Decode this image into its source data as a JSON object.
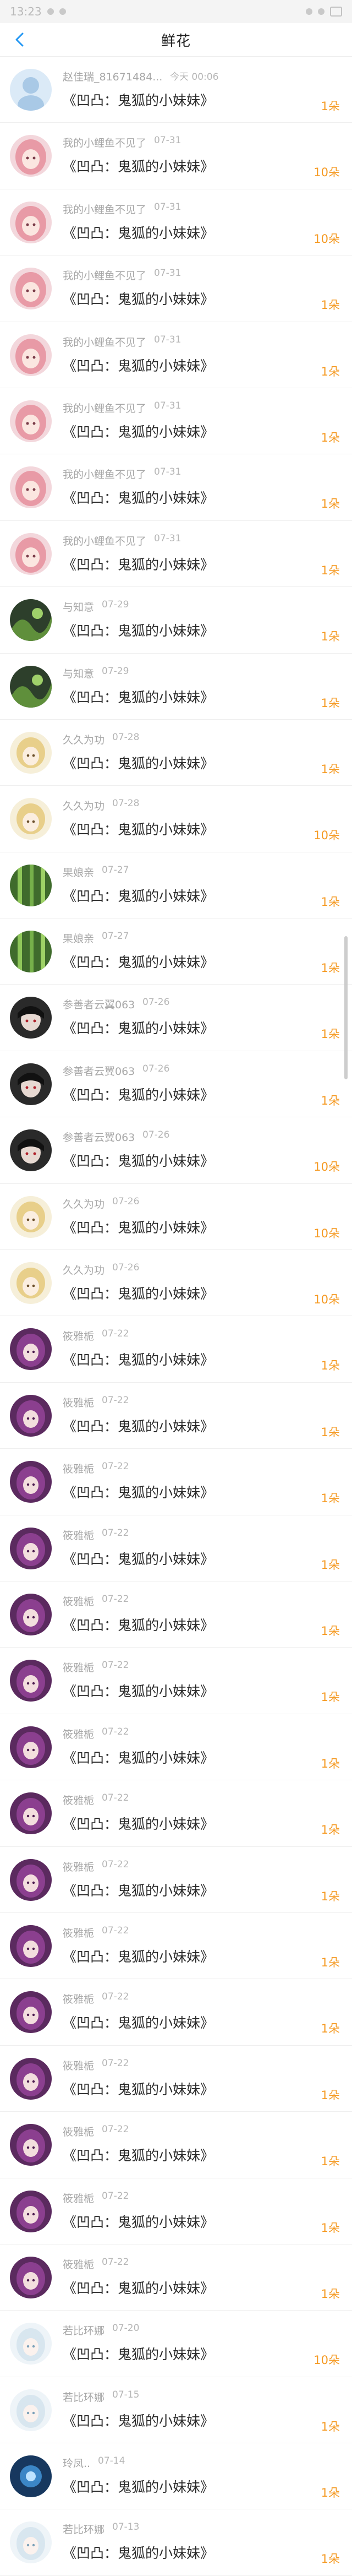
{
  "status": {
    "time": "13:23"
  },
  "header": {
    "title": "鲜花"
  },
  "colors": {
    "accent_count": "#f59a23"
  },
  "rows": [
    {
      "name": "赵佳瑞_81671484...",
      "date": "今天 00:06",
      "gift": "《凹凸：鬼狐的小妹妹》",
      "count": "1朵",
      "avatar": "default"
    },
    {
      "name": "我的小鲤鱼不见了",
      "date": "07-31",
      "gift": "《凹凸：鬼狐的小妹妹》",
      "count": "10朵",
      "avatar": "pink"
    },
    {
      "name": "我的小鲤鱼不见了",
      "date": "07-31",
      "gift": "《凹凸：鬼狐的小妹妹》",
      "count": "10朵",
      "avatar": "pink"
    },
    {
      "name": "我的小鲤鱼不见了",
      "date": "07-31",
      "gift": "《凹凸：鬼狐的小妹妹》",
      "count": "1朵",
      "avatar": "pink"
    },
    {
      "name": "我的小鲤鱼不见了",
      "date": "07-31",
      "gift": "《凹凸：鬼狐的小妹妹》",
      "count": "1朵",
      "avatar": "pink"
    },
    {
      "name": "我的小鲤鱼不见了",
      "date": "07-31",
      "gift": "《凹凸：鬼狐的小妹妹》",
      "count": "1朵",
      "avatar": "pink"
    },
    {
      "name": "我的小鲤鱼不见了",
      "date": "07-31",
      "gift": "《凹凸：鬼狐的小妹妹》",
      "count": "1朵",
      "avatar": "pink"
    },
    {
      "name": "我的小鲤鱼不见了",
      "date": "07-31",
      "gift": "《凹凸：鬼狐的小妹妹》",
      "count": "1朵",
      "avatar": "pink"
    },
    {
      "name": "与知意",
      "date": "07-29",
      "gift": "《凹凸：鬼狐的小妹妹》",
      "count": "1朵",
      "avatar": "greendark"
    },
    {
      "name": "与知意",
      "date": "07-29",
      "gift": "《凹凸：鬼狐的小妹妹》",
      "count": "1朵",
      "avatar": "greendark"
    },
    {
      "name": "久久为功",
      "date": "07-28",
      "gift": "《凹凸：鬼狐的小妹妹》",
      "count": "1朵",
      "avatar": "blonde"
    },
    {
      "name": "久久为功",
      "date": "07-28",
      "gift": "《凹凸：鬼狐的小妹妹》",
      "count": "10朵",
      "avatar": "blonde"
    },
    {
      "name": "果娘亲",
      "date": "07-27",
      "gift": "《凹凸：鬼狐的小妹妹》",
      "count": "1朵",
      "avatar": "bamboo"
    },
    {
      "name": "果娘亲",
      "date": "07-27",
      "gift": "《凹凸：鬼狐的小妹妹》",
      "count": "1朵",
      "avatar": "bamboo"
    },
    {
      "name": "参善者云翼063",
      "date": "07-26",
      "gift": "《凹凸：鬼狐的小妹妹》",
      "count": "1朵",
      "avatar": "dark"
    },
    {
      "name": "参善者云翼063",
      "date": "07-26",
      "gift": "《凹凸：鬼狐的小妹妹》",
      "count": "1朵",
      "avatar": "dark"
    },
    {
      "name": "参善者云翼063",
      "date": "07-26",
      "gift": "《凹凸：鬼狐的小妹妹》",
      "count": "10朵",
      "avatar": "dark"
    },
    {
      "name": "久久为功",
      "date": "07-26",
      "gift": "《凹凸：鬼狐的小妹妹》",
      "count": "10朵",
      "avatar": "blonde"
    },
    {
      "name": "久久为功",
      "date": "07-26",
      "gift": "《凹凸：鬼狐的小妹妹》",
      "count": "10朵",
      "avatar": "blonde"
    },
    {
      "name": "筱雅栀",
      "date": "07-22",
      "gift": "《凹凸：鬼狐的小妹妹》",
      "count": "1朵",
      "avatar": "purple"
    },
    {
      "name": "筱雅栀",
      "date": "07-22",
      "gift": "《凹凸：鬼狐的小妹妹》",
      "count": "1朵",
      "avatar": "purple"
    },
    {
      "name": "筱雅栀",
      "date": "07-22",
      "gift": "《凹凸：鬼狐的小妹妹》",
      "count": "1朵",
      "avatar": "purple"
    },
    {
      "name": "筱雅栀",
      "date": "07-22",
      "gift": "《凹凸：鬼狐的小妹妹》",
      "count": "1朵",
      "avatar": "purple"
    },
    {
      "name": "筱雅栀",
      "date": "07-22",
      "gift": "《凹凸：鬼狐的小妹妹》",
      "count": "1朵",
      "avatar": "purple"
    },
    {
      "name": "筱雅栀",
      "date": "07-22",
      "gift": "《凹凸：鬼狐的小妹妹》",
      "count": "1朵",
      "avatar": "purple"
    },
    {
      "name": "筱雅栀",
      "date": "07-22",
      "gift": "《凹凸：鬼狐的小妹妹》",
      "count": "1朵",
      "avatar": "purple"
    },
    {
      "name": "筱雅栀",
      "date": "07-22",
      "gift": "《凹凸：鬼狐的小妹妹》",
      "count": "1朵",
      "avatar": "purple"
    },
    {
      "name": "筱雅栀",
      "date": "07-22",
      "gift": "《凹凸：鬼狐的小妹妹》",
      "count": "1朵",
      "avatar": "purple"
    },
    {
      "name": "筱雅栀",
      "date": "07-22",
      "gift": "《凹凸：鬼狐的小妹妹》",
      "count": "1朵",
      "avatar": "purple"
    },
    {
      "name": "筱雅栀",
      "date": "07-22",
      "gift": "《凹凸：鬼狐的小妹妹》",
      "count": "1朵",
      "avatar": "purple"
    },
    {
      "name": "筱雅栀",
      "date": "07-22",
      "gift": "《凹凸：鬼狐的小妹妹》",
      "count": "1朵",
      "avatar": "purple"
    },
    {
      "name": "筱雅栀",
      "date": "07-22",
      "gift": "《凹凸：鬼狐的小妹妹》",
      "count": "1朵",
      "avatar": "purple"
    },
    {
      "name": "筱雅栀",
      "date": "07-22",
      "gift": "《凹凸：鬼狐的小妹妹》",
      "count": "1朵",
      "avatar": "purple"
    },
    {
      "name": "筱雅栀",
      "date": "07-22",
      "gift": "《凹凸：鬼狐的小妹妹》",
      "count": "1朵",
      "avatar": "purple"
    },
    {
      "name": "若比环娜",
      "date": "07-20",
      "gift": "《凹凸：鬼狐的小妹妹》",
      "count": "10朵",
      "avatar": "pale"
    },
    {
      "name": "若比环娜",
      "date": "07-15",
      "gift": "《凹凸：鬼狐的小妹妹》",
      "count": "1朵",
      "avatar": "pale"
    },
    {
      "name": "玲凤..",
      "date": "07-14",
      "gift": "《凹凸：鬼狐的小妹妹》",
      "count": "1朵",
      "avatar": "blue"
    },
    {
      "name": "若比环娜",
      "date": "07-13",
      "gift": "《凹凸：鬼狐的小妹妹》",
      "count": "1朵",
      "avatar": "pale"
    }
  ]
}
